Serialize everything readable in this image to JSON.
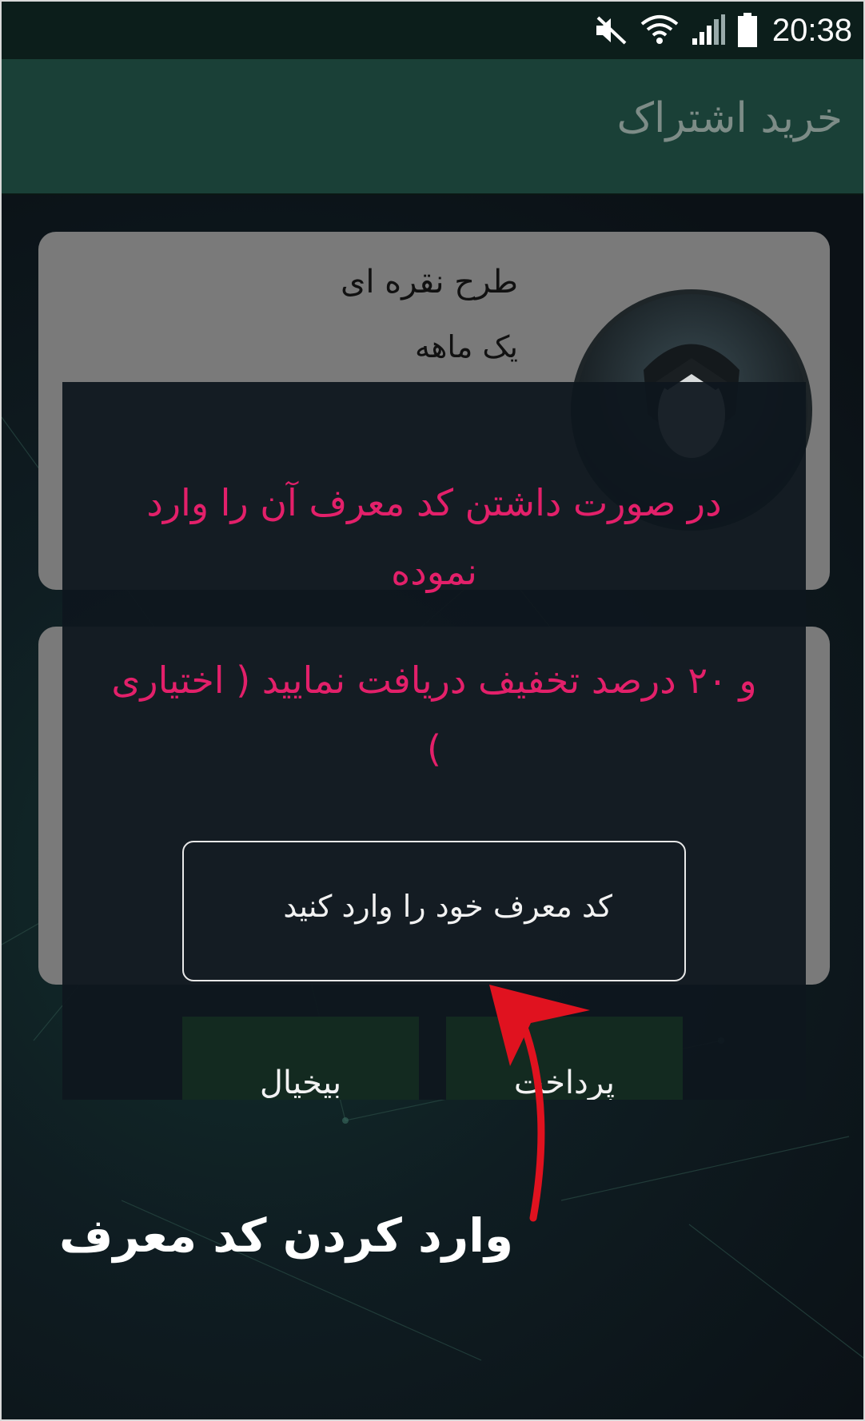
{
  "status_bar": {
    "time": "20:38",
    "icons": [
      "mute-icon",
      "wifi-icon",
      "signal-icon",
      "battery-icon"
    ]
  },
  "app_bar": {
    "title": "خرید اشتراک"
  },
  "cards": [
    {
      "title": "طرح نقره ای",
      "subtitle": "یک ماهه"
    }
  ],
  "dialog": {
    "message_1": "در صورت داشتن کد معرف آن را وارد نموده",
    "message_2": "و ۲۰ درصد تخفیف دریافت نمایید ( اختیاری )",
    "code_input": {
      "value": "",
      "placeholder": "کد معرف خود را وارد کنید"
    },
    "cancel_label": "بیخیال",
    "pay_label": "پرداخت"
  },
  "annotation": {
    "caption": "وارد کردن کد معرف"
  },
  "colors": {
    "accent": "#e3206a",
    "app_bar": "#1a4037",
    "status_bar": "#0c1e1b",
    "arrow": "#e0121f"
  }
}
